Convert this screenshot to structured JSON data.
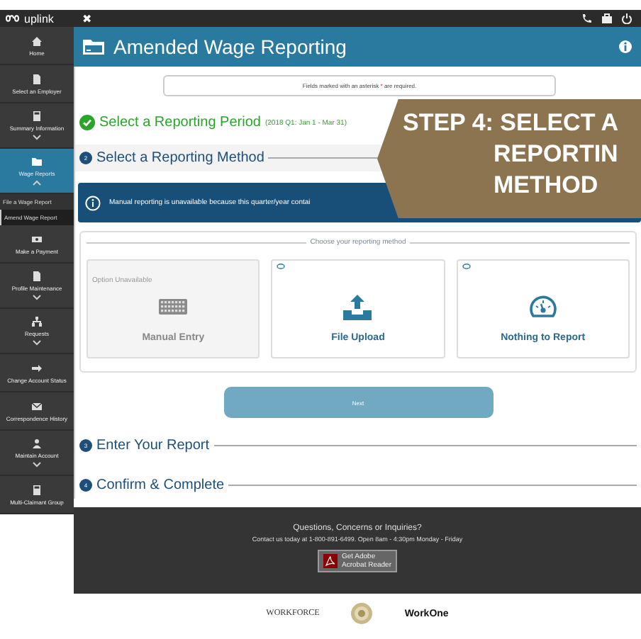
{
  "logo": {
    "text": "uplink"
  },
  "topbar": {
    "close_glyph": "✖"
  },
  "sidebar": {
    "items": [
      {
        "label": "Home",
        "kind": "home",
        "expandable": false,
        "selected": false
      },
      {
        "label": "Select an Employer",
        "kind": "doc",
        "expandable": false,
        "selected": false
      },
      {
        "label": "Summary Information",
        "kind": "calc",
        "expandable": true,
        "expanded": false,
        "selected": false
      },
      {
        "label": "Wage Reports",
        "kind": "folder",
        "expandable": true,
        "expanded": true,
        "selected": true,
        "children": [
          {
            "label": "File a Wage Report",
            "selected": false
          },
          {
            "label": "Amend Wage Report",
            "selected": true
          }
        ]
      },
      {
        "label": "Make a Payment",
        "kind": "money",
        "expandable": false,
        "selected": false
      },
      {
        "label": "Profile Maintenance",
        "kind": "doc",
        "expandable": true,
        "expanded": false,
        "selected": false
      },
      {
        "label": "Requests",
        "kind": "tree",
        "expandable": true,
        "expanded": false,
        "selected": false
      },
      {
        "label": "Change Account Status",
        "kind": "arrow",
        "expandable": false,
        "selected": false
      },
      {
        "label": "Correspondence History",
        "kind": "mail",
        "expandable": false,
        "selected": false
      },
      {
        "label": "Maintain Account",
        "kind": "users",
        "expandable": true,
        "expanded": false,
        "selected": false
      },
      {
        "label": "Multi-Claimant Group",
        "kind": "calc",
        "expandable": false,
        "selected": false
      }
    ]
  },
  "header": {
    "title": "Amended Wage Reporting"
  },
  "notice": {
    "before": "Fields marked with an asterisk ",
    "mark": "*",
    "after": " are required."
  },
  "steps": [
    {
      "title": "Select a Reporting Period",
      "subtitle": "(2018 Q1: Jan 1 - Mar 31)",
      "completed": true,
      "selected": false
    },
    {
      "number": "2",
      "title": "Select a Reporting Method",
      "completed": false,
      "selected": true
    },
    {
      "number": "3",
      "title": "Enter Your Report",
      "completed": false,
      "selected": false
    },
    {
      "number": "4",
      "title": "Confirm & Complete",
      "completed": false,
      "selected": false
    }
  ],
  "alert": {
    "text": "Manual reporting is unavailable because this quarter/year contai"
  },
  "method_panel": {
    "legend": "Choose your reporting method",
    "methods": [
      {
        "label": "Manual Entry",
        "kind": "keyboard",
        "disabled": true,
        "note": "Option Unavailable",
        "selected": false
      },
      {
        "label": "File Upload",
        "kind": "upload",
        "disabled": false,
        "selected": false
      },
      {
        "label": "Nothing to Report",
        "kind": "gauge",
        "disabled": false,
        "selected": false
      }
    ]
  },
  "next_button": {
    "label": "Next",
    "disabled": true
  },
  "callout": {
    "lines": [
      "STEP 4: SELECT A",
      "REPORTIN",
      "METHOD"
    ]
  },
  "footer": {
    "heading": "Questions, Concerns or Inquiries?",
    "contact": "Contact us today at 1-800-891-6499. Open 8am - 4:30pm Monday - Friday",
    "badge_small": "Get Adobe",
    "badge_main": "Acrobat Reader"
  },
  "partner_logos": [
    {
      "text": "WORKFORCE",
      "kind": "wordmark"
    },
    {
      "kind": "seal"
    },
    {
      "text": "WorkOne",
      "kind": "brand"
    }
  ]
}
